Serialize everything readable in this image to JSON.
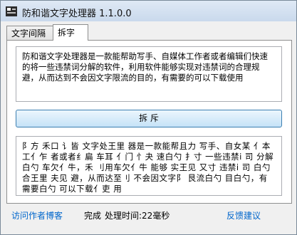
{
  "window": {
    "title": "防和谐文字处理器 1.1.0.0"
  },
  "tabs": [
    {
      "label": "文字间隔",
      "active": false
    },
    {
      "label": "拆字",
      "active": true
    }
  ],
  "input_text": "防和谐文字处理器是一款能帮助写手、自媒体工作者或者编辑们快速的将一些违禁词分解的软件，利用软件能够实现对违禁词的合理规避，从而达到不会因文字限流的目的，有需要的可以下载使用",
  "split_button_label": "拆 斥",
  "output_text": "阝方 禾口 讠皆 文字处王里 器是一款能帮且力 写手、自女某 亻本 工亻乍 者或者纟扁 车耳 亻门 忄夬 速白勺 扌寸 一些违禁i 司 分解白勺 车欠亻牛，禾 刂用车欠亻牛 能够 实王见 又寸 违禁i 司 白勺 合王里 夫见 避，从而达至刂 不会因文字阝 艮流白勺 目白勺，有需要白勺 可以下载亻吏 用",
  "status": {
    "blog_link": "访问作者博客",
    "status_text": "完成",
    "time_text": "处理时间:22毫秒",
    "feedback_link": "反馈建议"
  },
  "colors": {
    "link": "#0066cc",
    "button_border": "#3c7fb1"
  }
}
